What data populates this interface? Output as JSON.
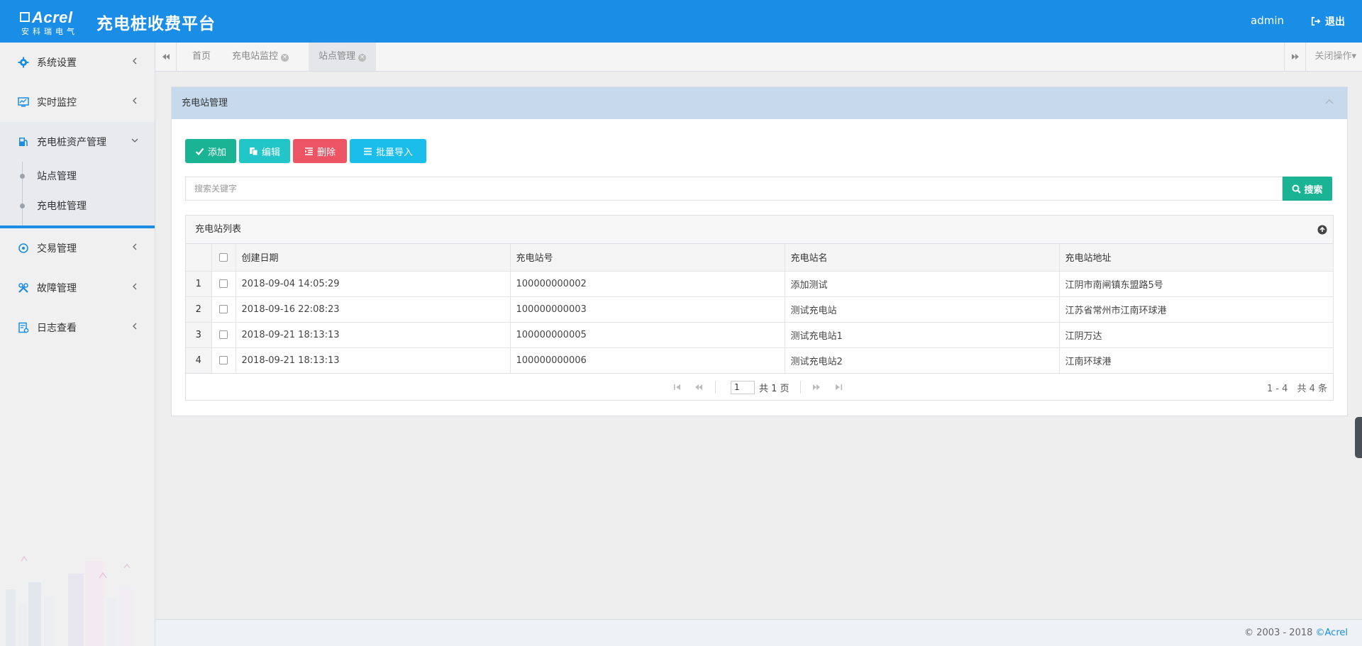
{
  "header": {
    "logo_text": "Acrel",
    "logo_sub": "安科瑞电气",
    "title": "充电桩收费平台",
    "user": "admin",
    "logout_label": "退出"
  },
  "sidebar": {
    "items": [
      {
        "label": "系统设置",
        "icon": "gear-icon"
      },
      {
        "label": "实时监控",
        "icon": "monitor-icon"
      },
      {
        "label": "充电桩资产管理",
        "icon": "fuel-pump-icon"
      },
      {
        "label": "交易管理",
        "icon": "exchange-icon"
      },
      {
        "label": "故障管理",
        "icon": "tools-icon"
      },
      {
        "label": "日志查看",
        "icon": "log-icon"
      }
    ],
    "sub_items": [
      {
        "label": "站点管理"
      },
      {
        "label": "充电桩管理"
      }
    ]
  },
  "tabs": {
    "items": [
      {
        "label": "首页"
      },
      {
        "label": "充电站监控"
      },
      {
        "label": "站点管理"
      }
    ],
    "close_ops": "关闭操作▾"
  },
  "panel": {
    "title": "充电站管理"
  },
  "toolbar": {
    "add_label": "添加",
    "edit_label": "编辑",
    "delete_label": "删除",
    "import_label": "批量导入",
    "add_color": "#1ab394",
    "edit_color": "#23c6c8",
    "delete_color": "#ed5565",
    "import_color": "#1bbdeb"
  },
  "search": {
    "placeholder": "搜索关键字",
    "button_label": "搜索"
  },
  "grid": {
    "title": "充电站列表",
    "columns": [
      "创建日期",
      "充电站号",
      "充电站名",
      "充电站地址"
    ],
    "rows": [
      {
        "num": "1",
        "date": "2018-09-04 14:05:29",
        "code": "100000000002",
        "name": "添加测试",
        "address": "江阴市南闸镇东盟路5号"
      },
      {
        "num": "2",
        "date": "2018-09-16 22:08:23",
        "code": "100000000003",
        "name": "测试充电站",
        "address": "江苏省常州市江南环球港"
      },
      {
        "num": "3",
        "date": "2018-09-21 18:13:13",
        "code": "100000000005",
        "name": "测试充电站1",
        "address": "江阴万达"
      },
      {
        "num": "4",
        "date": "2018-09-21 18:13:13",
        "code": "100000000006",
        "name": "测试充电站2",
        "address": "江南环球港"
      }
    ],
    "pager": {
      "page": "1",
      "total_pages": "共 1 页",
      "range": "1 - 4　共 4 条"
    }
  },
  "footer": {
    "copyright": "© 2003 - 2018 ",
    "brand": "©Acrel"
  }
}
